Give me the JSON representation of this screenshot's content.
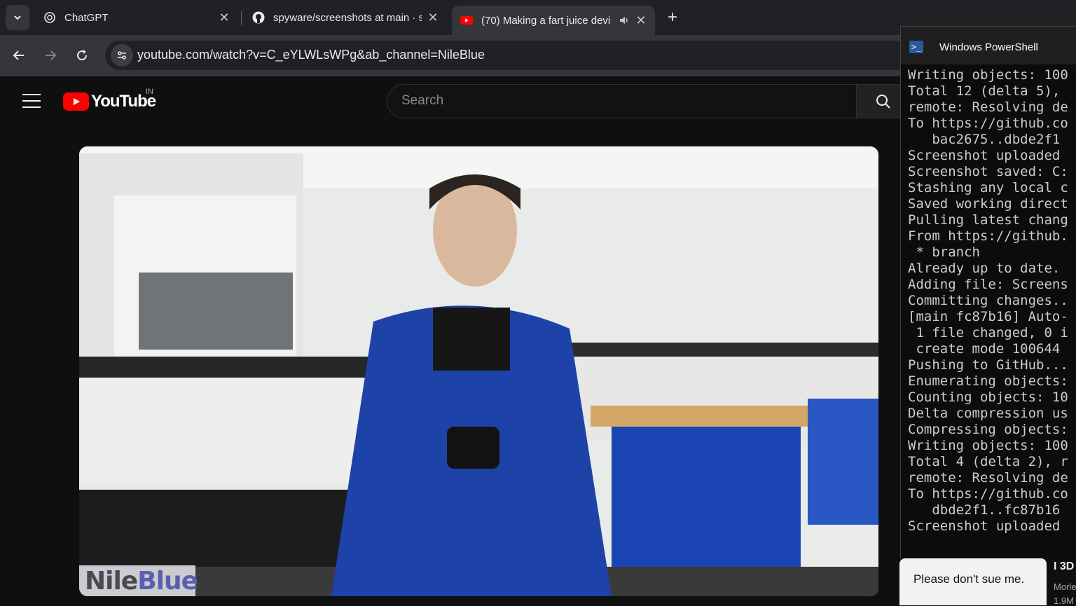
{
  "browser": {
    "tabs": [
      {
        "title": "ChatGPT",
        "icon": "chatgpt-icon",
        "active": false
      },
      {
        "title": "spyware/screenshots at main · s",
        "icon": "github-icon",
        "active": false
      },
      {
        "title": "(70) Making a fart juice devi",
        "icon": "youtube-icon",
        "active": true,
        "audio": true
      }
    ],
    "url": "youtube.com/watch?v=C_eYLWLsWPg&ab_channel=NileBlue"
  },
  "youtube": {
    "logo_text": "YouTube",
    "country_code": "IN",
    "search_placeholder": "Search",
    "watermark_prefix": "Nile",
    "watermark_suffix": "Blue",
    "related": {
      "thumb_caption": "Please don't sue me.",
      "title": "I 3D",
      "channel": "Morle",
      "views": "1.9M"
    }
  },
  "powershell": {
    "title": "Windows PowerShell",
    "lines": [
      "Writing objects: 100",
      "Total 12 (delta 5),",
      "remote: Resolving de",
      "To https://github.co",
      "   bac2675..dbde2f1",
      "Screenshot uploaded",
      "Screenshot saved: C:",
      "Stashing any local c",
      "Saved working direct",
      "Pulling latest chang",
      "From https://github.",
      " * branch",
      "Already up to date.",
      "Adding file: Screens",
      "Committing changes..",
      "[main fc87b16] Auto-",
      " 1 file changed, 0 i",
      " create mode 100644",
      "Pushing to GitHub...",
      "Enumerating objects:",
      "Counting objects: 10",
      "Delta compression us",
      "Compressing objects:",
      "Writing objects: 100",
      "Total 4 (delta 2), r",
      "remote: Resolving de",
      "To https://github.co",
      "   dbde2f1..fc87b16",
      "Screenshot uploaded"
    ]
  },
  "colors": {
    "yt_red": "#ff0000",
    "chrome_dark": "#202124",
    "chrome_toolbar": "#35363a",
    "terminal_bg": "#0c0c0c",
    "terminal_text": "#cccccc"
  }
}
